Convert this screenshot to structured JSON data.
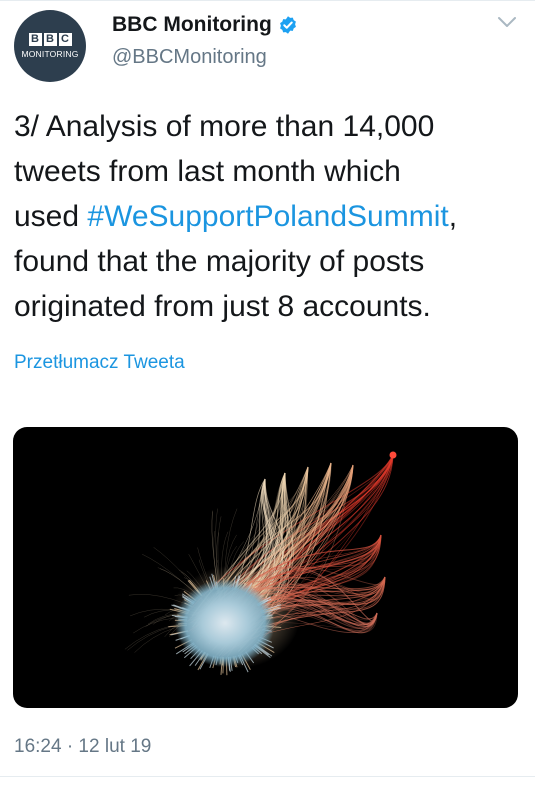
{
  "author": {
    "avatar_logo": "BBC",
    "avatar_logo_sub": "MONITORING",
    "display_name": "BBC Monitoring",
    "verified": true,
    "handle": "@BBCMonitoring"
  },
  "tweet": {
    "text_before": "3/ Analysis of more than 14,000\ntweets from last month which\nused ",
    "hashtag": "#WeSupportPolandSummit",
    "text_after": ",\nfound that the majority of posts\noriginated from just 8 accounts.",
    "translate_link": "Przetłumacz Tweeta",
    "timestamp": "16:24 · 12 lut 19"
  },
  "media": {
    "description_icon": "network-graph-image"
  },
  "colors": {
    "link": "#1b95e0",
    "text": "#14171a",
    "muted": "#657786",
    "verified": "#1da1f2"
  },
  "icons": {
    "verified": "verified-badge-icon",
    "menu": "chevron-down-icon"
  }
}
